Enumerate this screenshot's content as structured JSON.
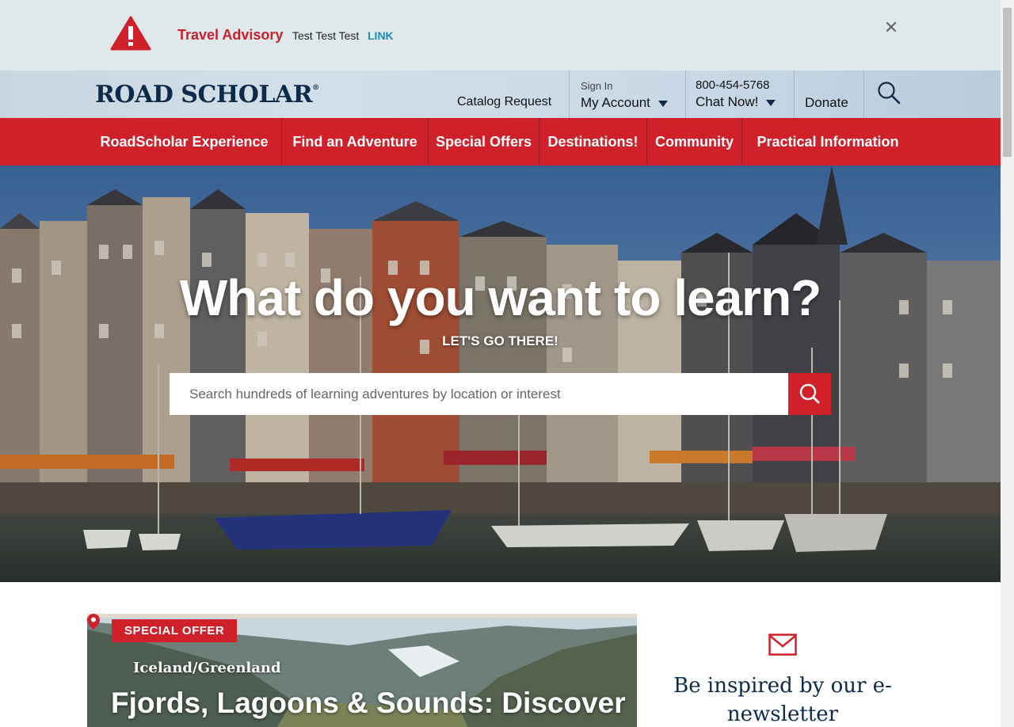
{
  "advisory": {
    "title": "Travel Advisory",
    "text": "Test Test Test",
    "link": "LINK",
    "icon": "warning-triangle-icon",
    "close_icon": "close-icon"
  },
  "header": {
    "logo": "ROAD SCHOLAR",
    "logo_mark": "®",
    "catalog": "Catalog Request",
    "signin_label": "Sign In",
    "account": "My Account",
    "phone": "800-454-5768",
    "chat": "Chat Now!",
    "donate": "Donate",
    "search_icon": "search-icon"
  },
  "nav": {
    "items": [
      "RoadScholar Experience",
      "Find an Adventure",
      "Special Offers",
      "Destinations!",
      "Community",
      "Practical Information"
    ]
  },
  "hero": {
    "title": "What do you want to learn?",
    "subtitle": "LET'S GO THERE!",
    "search_placeholder": "Search hundreds of learning adventures by location or interest"
  },
  "promo": {
    "badge": "SPECIAL OFFER",
    "location": "Iceland/Greenland",
    "title": "Fjords, Lagoons & Sounds: Discover"
  },
  "newsletter": {
    "icon": "envelope-icon",
    "text": "Be inspired by our e-newsletter"
  },
  "colors": {
    "brand_red": "#d0202a",
    "navy": "#0d2a4a",
    "advisory_bg": "#dfe9ec",
    "link_blue": "#1a8db8"
  }
}
